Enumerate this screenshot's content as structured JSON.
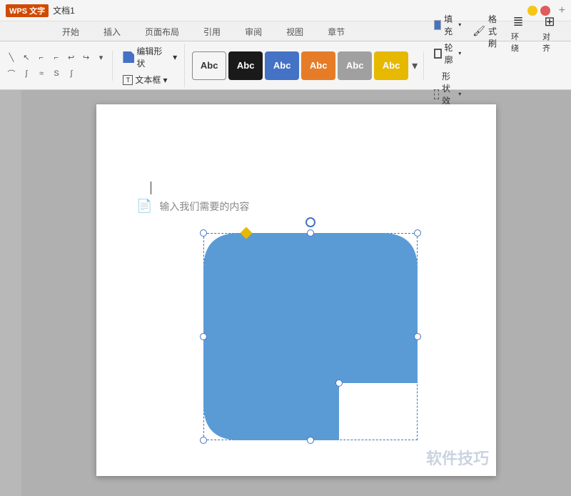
{
  "titleBar": {
    "logo": "WPS 文字",
    "docName": "文档1",
    "plusBtn": "+"
  },
  "tabs": [
    {
      "label": "开始",
      "active": false
    },
    {
      "label": "插入",
      "active": false
    },
    {
      "label": "页面布局",
      "active": false
    },
    {
      "label": "引用",
      "active": false
    },
    {
      "label": "审阅",
      "active": false
    },
    {
      "label": "视图",
      "active": false
    },
    {
      "label": "章节",
      "active": false
    }
  ],
  "ribbon": {
    "editShapeLabel": "编辑形状",
    "textboxLabel": "文本框",
    "swatches": [
      {
        "label": "Abc",
        "type": "white"
      },
      {
        "label": "Abc",
        "type": "black"
      },
      {
        "label": "Abc",
        "type": "blue"
      },
      {
        "label": "Abc",
        "type": "orange"
      },
      {
        "label": "Abc",
        "type": "gray"
      },
      {
        "label": "Abc",
        "type": "yellow"
      }
    ],
    "fillLabel": "填充",
    "formatBrushLabel": "格式刷",
    "outlineLabel": "轮廓",
    "shapeEffectLabel": "形状效果",
    "wrapLabel": "环绕",
    "alignLabel": "对齐"
  },
  "document": {
    "placeholder": "输入我们需要的内容",
    "watermark": "软件技巧"
  }
}
